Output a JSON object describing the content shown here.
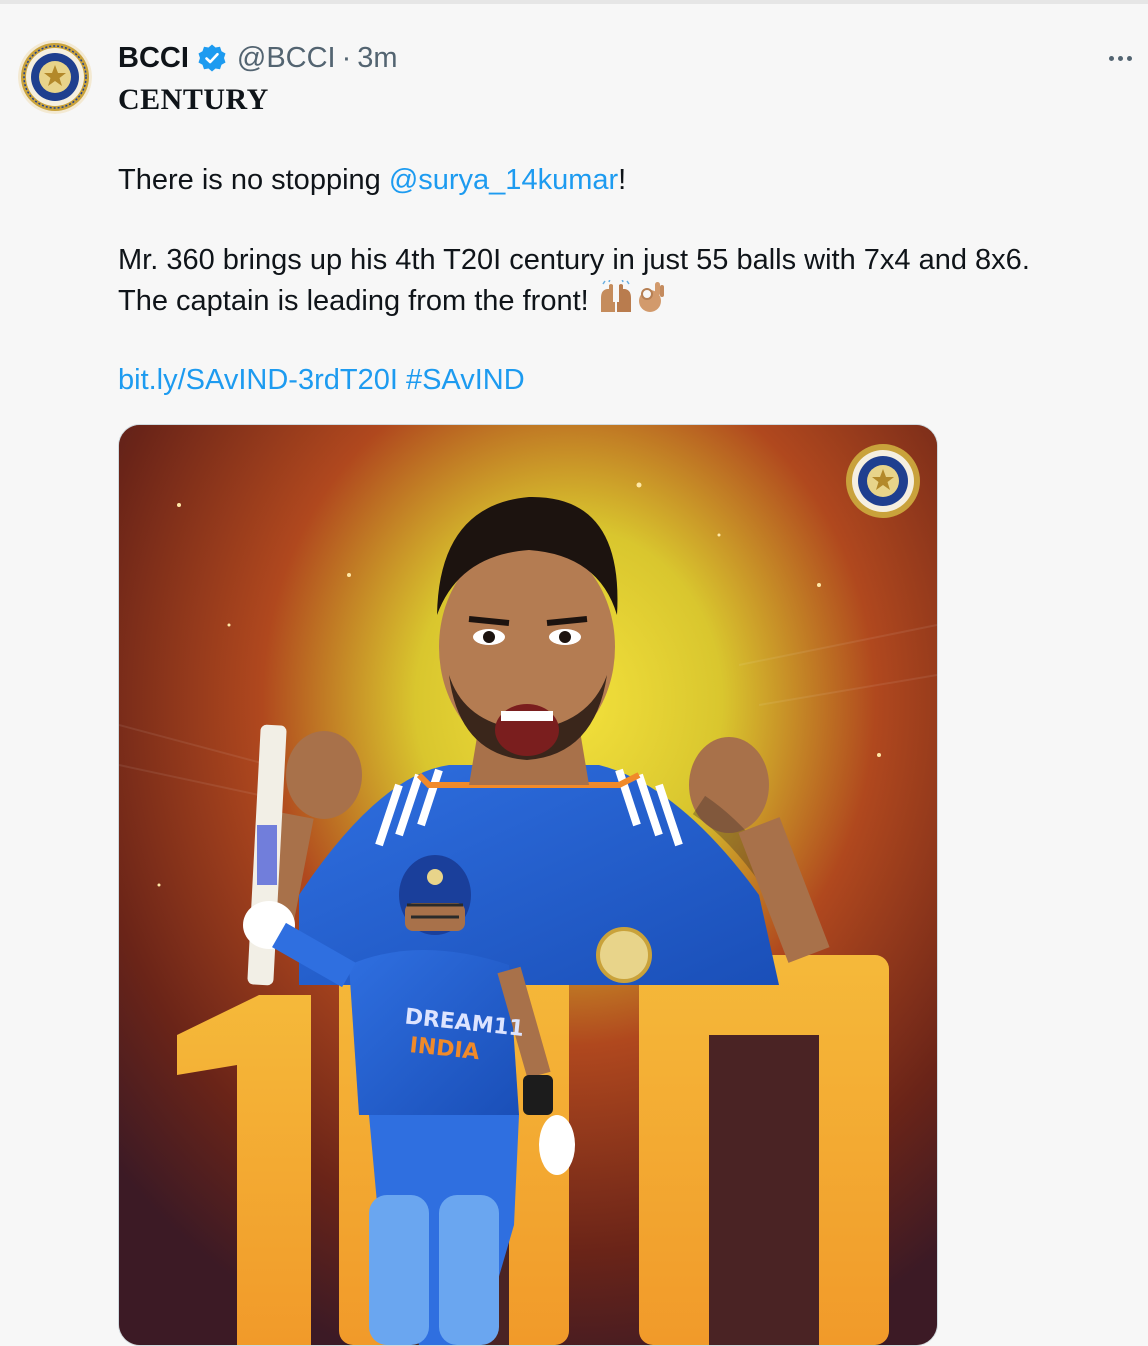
{
  "tweet": {
    "display_name": "BCCI",
    "handle": "@BCCI",
    "separator": "·",
    "timestamp": "3m",
    "headline": "CENTURY",
    "body": {
      "line1_prefix": "There is no stopping ",
      "line1_mention": "@surya_14kumar",
      "line1_suffix": "!",
      "line2": "Mr. 360 brings up his 4th T20I century in just 55  balls with 7x4 and 8x6.",
      "line3": "The captain is leading from the front!",
      "link": "bit.ly/SAvIND-3rdT20I",
      "hashtag": "#SAvIND"
    },
    "media": {
      "big_number": "100",
      "jersey_text_1": "DREAM11",
      "jersey_text_2": "INDIA"
    }
  },
  "icons": {
    "avatar": "bcci-logo",
    "verified": "verified-badge-icon",
    "more": "more-options-icon",
    "emoji_1": "raising-hands-emoji",
    "emoji_2": "ok-hand-emoji"
  },
  "colors": {
    "link": "#1d9bf0",
    "muted": "#536471",
    "text": "#0f1419",
    "background": "#f7f7f7"
  }
}
